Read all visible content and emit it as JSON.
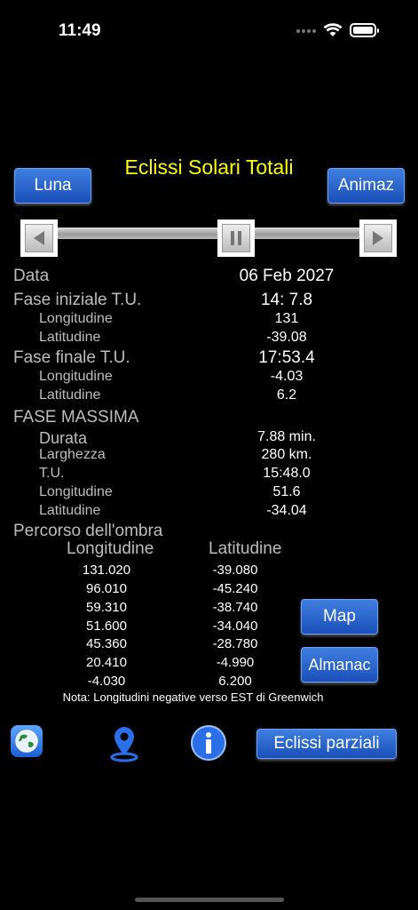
{
  "status": {
    "time": "11:49"
  },
  "header": {
    "title": "Eclissi Solari Totali",
    "left_button": "Luna",
    "right_button": "Animaz"
  },
  "info": {
    "data_label": "Data",
    "data_value": "06 Feb 2027",
    "fase_iniziale_label": "Fase iniziale T.U.",
    "fase_iniziale_value": "14: 7.8",
    "fi_long_label": "Longitudine",
    "fi_long_value": "131",
    "fi_lat_label": "Latitudine",
    "fi_lat_value": "-39.08",
    "fase_finale_label": "Fase finale T.U.",
    "fase_finale_value": "17:53.4",
    "ff_long_label": "Longitudine",
    "ff_long_value": "-4.03",
    "ff_lat_label": "Latitudine",
    "ff_lat_value": "6.2",
    "fase_massima_label": "FASE MASSIMA",
    "durata_label": "Durata",
    "durata_value": "7.88 min.",
    "larghezza_label": "Larghezza",
    "larghezza_value": "280 km.",
    "tu_label": "T.U.",
    "tu_value": "15:48.0",
    "fm_long_label": "Longitudine",
    "fm_long_value": "51.6",
    "fm_lat_label": "Latitudine",
    "fm_lat_value": "-34.04"
  },
  "path": {
    "title": "Percorso dell'ombra",
    "col_long": "Longitudine",
    "col_lat": "Latitudine",
    "rows": [
      {
        "lon": "131.020",
        "lat": "-39.080"
      },
      {
        "lon": "96.010",
        "lat": "-45.240"
      },
      {
        "lon": "59.310",
        "lat": "-38.740"
      },
      {
        "lon": "51.600",
        "lat": "-34.040"
      },
      {
        "lon": "45.360",
        "lat": "-28.780"
      },
      {
        "lon": "20.410",
        "lat": "-4.990"
      },
      {
        "lon": "-4.030",
        "lat": "6.200"
      }
    ],
    "note": "Nota: Longitudini negative verso EST di Greenwich"
  },
  "buttons": {
    "map": "Map",
    "almanac": "Almanac",
    "partial": "Eclissi parziali"
  },
  "icons": {
    "globe": "globe-icon",
    "pin": "location-pin-icon",
    "info": "info-icon"
  },
  "colors": {
    "title": "#ffff00",
    "button": "#2a62cc"
  }
}
